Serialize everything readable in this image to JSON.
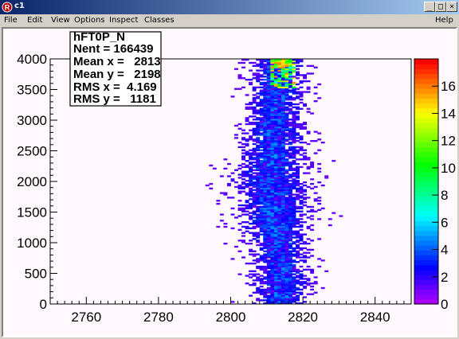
{
  "window": {
    "title": "c1",
    "buttons": {
      "minimize": "_",
      "maximize": "□",
      "close": "×"
    }
  },
  "menu": {
    "items": [
      "File",
      "Edit",
      "View",
      "Options",
      "Inspect",
      "Classes"
    ],
    "help": "Help"
  },
  "stats_box": {
    "name": "hFT0P_N",
    "lines": [
      "Nent = 166439",
      "Mean x =   2813",
      "Mean y =   2198",
      "RMS x =  4.169",
      "RMS y =   1181"
    ]
  },
  "chart_data": {
    "type": "heatmap",
    "title": "",
    "xlabel": "",
    "ylabel": "",
    "xlim": [
      2750,
      2850
    ],
    "ylim": [
      0,
      4000
    ],
    "x_ticks": [
      2760,
      2780,
      2800,
      2820,
      2840
    ],
    "y_ticks": [
      0,
      500,
      1000,
      1500,
      2000,
      2500,
      3000,
      3500,
      4000
    ],
    "z_ticks": [
      0,
      2,
      4,
      6,
      8,
      10,
      12,
      14,
      16
    ],
    "zlim": [
      0,
      18
    ],
    "entries": 166439,
    "mean_x": 2813,
    "mean_y": 2198,
    "rms_x": 4.169,
    "rms_y": 1181,
    "band_center": [
      [
        0,
        2814
      ],
      [
        500,
        2814
      ],
      [
        1000,
        2813
      ],
      [
        1500,
        2812
      ],
      [
        2000,
        2811
      ],
      [
        2500,
        2812
      ],
      [
        3000,
        2812
      ],
      [
        3500,
        2813
      ],
      [
        4000,
        2813
      ]
    ],
    "band_halfwidth": [
      [
        0,
        6
      ],
      [
        500,
        6
      ],
      [
        1000,
        6
      ],
      [
        1500,
        8
      ],
      [
        2000,
        8
      ],
      [
        2500,
        7
      ],
      [
        3000,
        6
      ],
      [
        3500,
        6
      ],
      [
        4000,
        6
      ]
    ],
    "grid": false,
    "palette": "rainbow (violet to red)"
  }
}
